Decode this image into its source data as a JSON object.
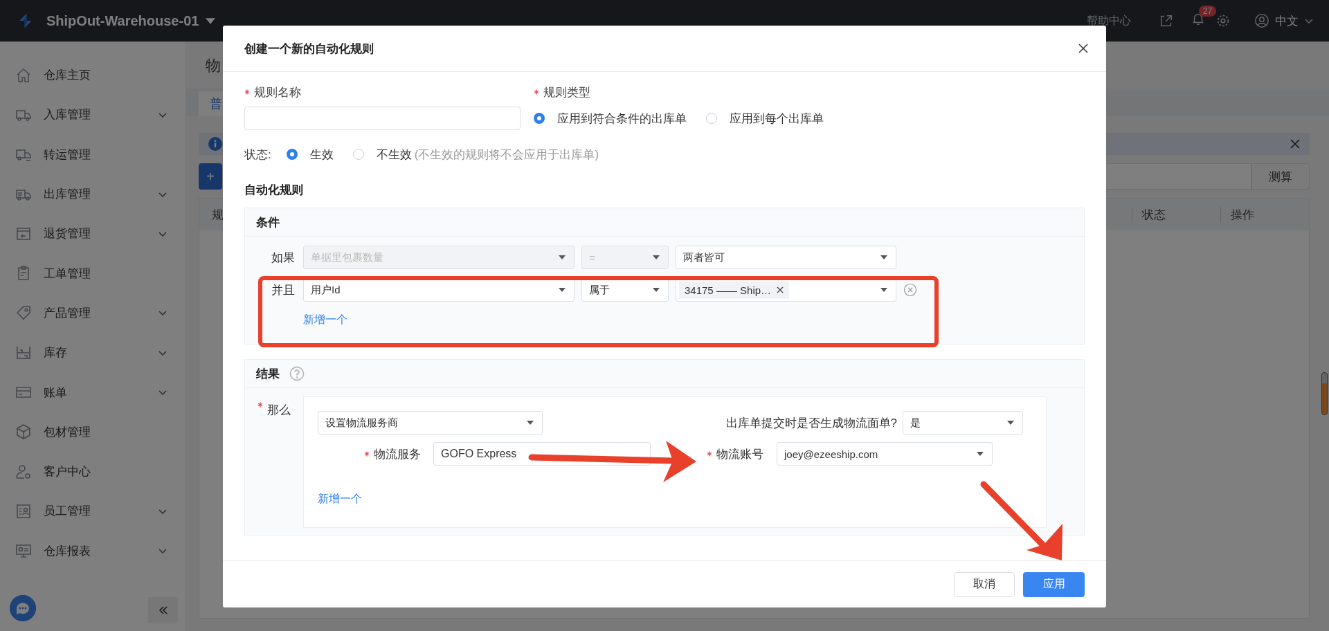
{
  "top_bar": {
    "title": "ShipOut-Warehouse-01",
    "help_link": "帮助中心",
    "notification_count": "27",
    "language": "中文"
  },
  "sidebar": {
    "items": [
      {
        "label": "仓库主页",
        "expandable": false
      },
      {
        "label": "入库管理",
        "expandable": true
      },
      {
        "label": "转运管理",
        "expandable": false
      },
      {
        "label": "出库管理",
        "expandable": true
      },
      {
        "label": "退货管理",
        "expandable": true
      },
      {
        "label": "工单管理",
        "expandable": false
      },
      {
        "label": "产品管理",
        "expandable": true
      },
      {
        "label": "库存",
        "expandable": true
      },
      {
        "label": "账单",
        "expandable": true
      },
      {
        "label": "包材管理",
        "expandable": false
      },
      {
        "label": "客户中心",
        "expandable": false
      },
      {
        "label": "员工管理",
        "expandable": true
      },
      {
        "label": "仓库报表",
        "expandable": true
      }
    ]
  },
  "page": {
    "title": "物",
    "tabs": [
      {
        "label": "普",
        "selected": true
      }
    ],
    "add_button": "+",
    "search_button": "测算",
    "table": {
      "columns": [
        "规",
        "状态",
        "操作"
      ]
    }
  },
  "dialog": {
    "title": "创建一个新的自动化规则",
    "rule_name": {
      "label": "规则名称",
      "required": true
    },
    "rule_type": {
      "label": "规则类型",
      "required": true,
      "options": [
        {
          "label": "应用到符合条件的出库单",
          "selected": true
        },
        {
          "label": "应用到每个出库单",
          "selected": false
        }
      ]
    },
    "status": {
      "label": "状态:",
      "options": [
        {
          "label": "生效",
          "selected": true
        },
        {
          "label": "不生效",
          "note": "(不生效的规则将不会应用于出库单)",
          "selected": false
        }
      ]
    },
    "section_title": "自动化规则",
    "conditions": {
      "title": "条件",
      "rows": [
        {
          "connector": "如果",
          "field": {
            "value": "单据里包裹数量",
            "disabled": true
          },
          "operator": {
            "value": "=",
            "disabled": true
          },
          "value": {
            "value": "两者皆可",
            "disabled": false
          },
          "removable": false
        },
        {
          "connector": "并且",
          "field": {
            "value": "用户Id",
            "disabled": false
          },
          "operator": {
            "value": "属于",
            "disabled": false
          },
          "value": {
            "tag": "34175 —— Ship…",
            "disabled": false
          },
          "removable": true
        }
      ],
      "add_link": "新增一个"
    },
    "results": {
      "title": "结果",
      "then_label": "那么",
      "action": "设置物流服务商",
      "generate_label": "出库单提交时是否生成物流面单?",
      "generate_value": "是",
      "service_label": "物流服务",
      "service_value": "GOFO Express",
      "account_label": "物流账号",
      "account_value": "joey@ezeeship.com",
      "add_link": "新增一个"
    },
    "buttons": {
      "cancel": "取消",
      "apply": "应用"
    }
  }
}
